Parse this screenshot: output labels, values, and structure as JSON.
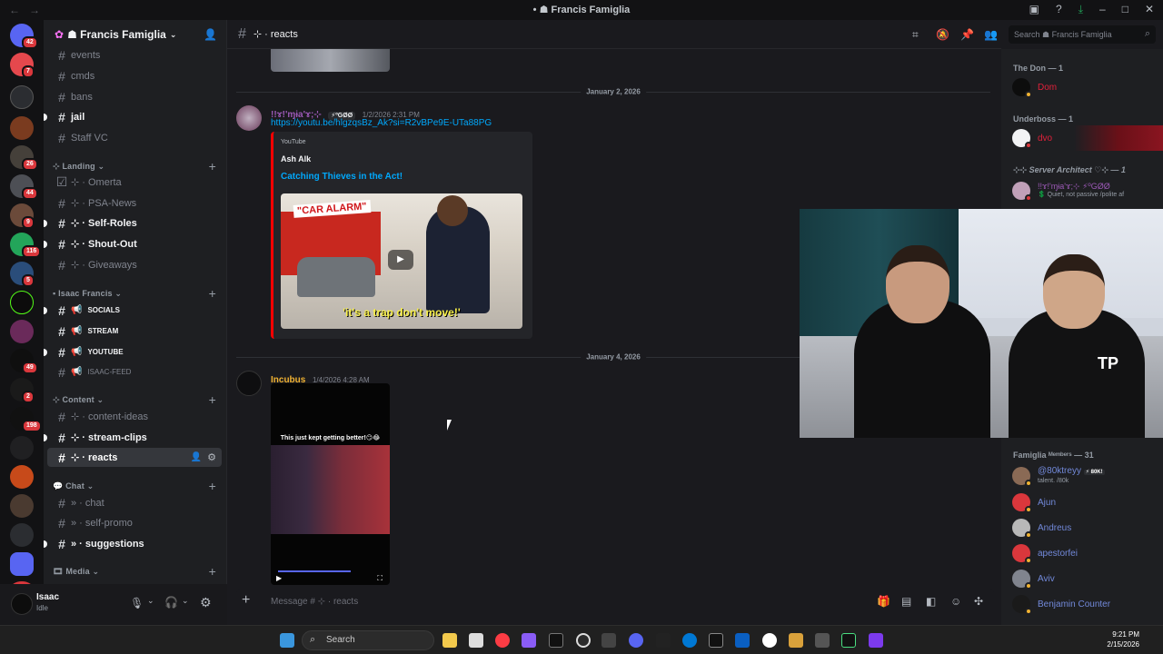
{
  "window": {
    "title": "• ☗ Francis Famiglia",
    "back": "←",
    "forward": "→"
  },
  "server": {
    "name": "☗ Francis Famiglia",
    "badges": [
      "42",
      "7",
      "26",
      "44",
      "9",
      "116",
      "5",
      "49",
      "2",
      "1",
      "198",
      "4"
    ]
  },
  "sidebar": {
    "channels_top": [
      {
        "name": "events"
      },
      {
        "name": "cmds"
      },
      {
        "name": "bans"
      },
      {
        "name": "jail"
      },
      {
        "name": "Staff VC"
      }
    ],
    "categories": [
      {
        "label": "⊹ Landing",
        "channels": [
          "⊹ · Omerta",
          "⊹ · PSA-News",
          "⊹ · Self-Roles",
          "⊹ · Shout-Out",
          "⊹ · Giveaways"
        ]
      },
      {
        "label": "Isaac Francis",
        "channels": [
          "SOCIALS",
          "STREAM",
          "YOUTUBE",
          "ISAAC-FEED"
        ]
      },
      {
        "label": "Content",
        "channels": [
          "⊹ · content-ideas",
          "⊹ · stream-clips",
          "⊹ · reacts"
        ]
      },
      {
        "label": "Chat",
        "channels": [
          "» · chat",
          "» · self-promo",
          "» · suggestions"
        ]
      },
      {
        "label": "Media",
        "channels": []
      }
    ]
  },
  "user": {
    "name": "Isaac",
    "status": "Idle"
  },
  "channel": {
    "name": "⊹ · reacts",
    "search_placeholder": "Search ☗ Francis Famiglia",
    "composer_placeholder": "Message # ⊹ · reacts"
  },
  "messages": [
    {
      "divider": "January 2, 2026",
      "author": "!!ɤ!'ɱɨa'ɤ;⊹",
      "tag": "⚡ºGØØ",
      "timestamp": "1/2/2026 2:31 PM",
      "link": "https://youtu.be/hlgzqsBz_Ak?si=R2vBPe9E-UTa88PG",
      "embed": {
        "provider": "YouTube",
        "author": "Ash Alk",
        "title": "Catching Thieves in the Act!",
        "thumb_text_top": "\"CAR ALARM\"",
        "thumb_caption": "'it's a trap don't move!'"
      }
    },
    {
      "divider": "January 4, 2026",
      "author": "Incubus",
      "timestamp": "1/4/2026 4:28 AM",
      "video_caption": "This just kept getting better!😏😂"
    }
  ],
  "members": {
    "groups": [
      {
        "label": "The Don — 1",
        "members": [
          {
            "name": "Dom",
            "color": "#e0203a"
          }
        ]
      },
      {
        "label": "Underboss — 1",
        "members": [
          {
            "name": "dvo",
            "color": "#e0203a"
          }
        ]
      },
      {
        "label": "⊹⊹ Server Architect ♡⊹ — 1",
        "members": [
          {
            "name": "!!ɤ!'ɱɨa'ɤ;⊹ ⚡ºGØØ",
            "status": "💲 Quiet, not passive /polite af",
            "color": "#9b59b6"
          }
        ]
      },
      {
        "label": "Famiglia ᴹᵉᵐᵇᵉʳˢ — 31",
        "members": [
          {
            "name": "@80ktreyy",
            "tag": "⚡ 80K!",
            "status": "talent. /80k",
            "color": "#7289da"
          },
          {
            "name": "Ajun",
            "color": "#7289da"
          },
          {
            "name": "Andreus",
            "color": "#7289da"
          },
          {
            "name": "apestorfei",
            "color": "#7289da"
          },
          {
            "name": "Aviv",
            "color": "#7289da"
          },
          {
            "name": "Benjamin Counter",
            "color": "#7289da"
          }
        ]
      }
    ]
  },
  "taskbar": {
    "search_placeholder": "Search",
    "time": "9:21 PM",
    "date": "2/15/2026"
  },
  "colors": {
    "accent": "#5865f2",
    "link": "#00a8fc",
    "embed_border": "#ff0000",
    "incubus": "#f0b232"
  }
}
